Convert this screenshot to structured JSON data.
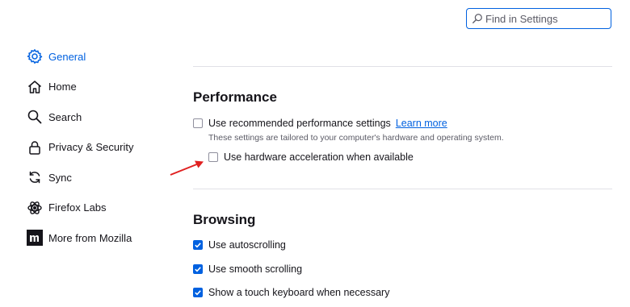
{
  "search": {
    "placeholder": "Find in Settings"
  },
  "sidebar": {
    "items": [
      {
        "label": "General",
        "icon": "gear-icon",
        "active": true
      },
      {
        "label": "Home",
        "icon": "home-icon"
      },
      {
        "label": "Search",
        "icon": "search-icon"
      },
      {
        "label": "Privacy & Security",
        "icon": "lock-icon"
      },
      {
        "label": "Sync",
        "icon": "sync-icon"
      },
      {
        "label": "Firefox Labs",
        "icon": "labs-icon"
      },
      {
        "label": "More from Mozilla",
        "icon": "mozilla-icon"
      }
    ]
  },
  "performance": {
    "title": "Performance",
    "recommended_label": "Use recommended performance settings",
    "recommended_checked": false,
    "learn_more": "Learn more",
    "description": "These settings are tailored to your computer's hardware and operating system.",
    "hardware_label": "Use hardware acceleration when available",
    "hardware_checked": false
  },
  "browsing": {
    "title": "Browsing",
    "options": [
      {
        "label": "Use autoscrolling",
        "checked": true
      },
      {
        "label": "Use smooth scrolling",
        "checked": true
      },
      {
        "label": "Show a touch keyboard when necessary",
        "checked": true
      }
    ]
  },
  "colors": {
    "accent": "#0061e0",
    "annotation_arrow": "#e02020"
  }
}
